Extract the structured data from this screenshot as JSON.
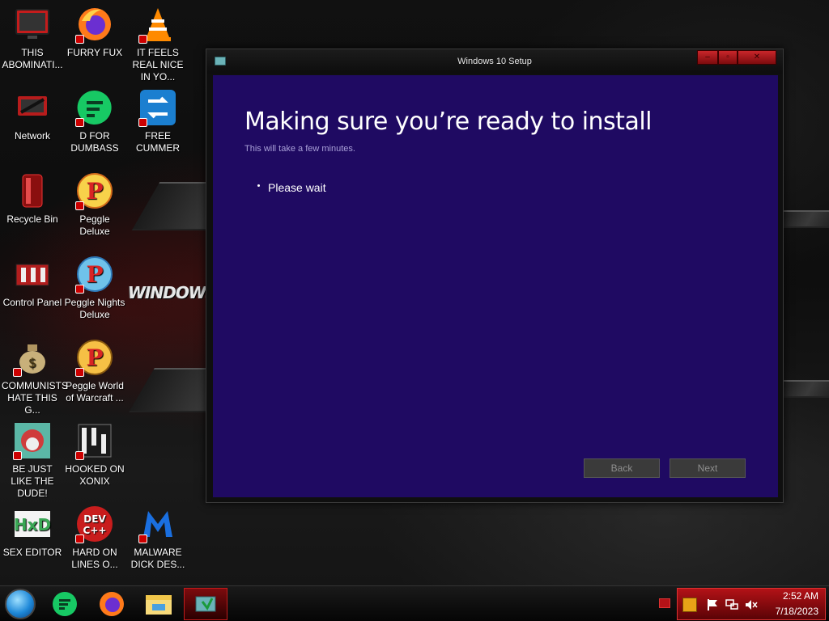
{
  "window": {
    "title": "Windows 10 Setup",
    "heading": "Making sure you’re ready to install",
    "subheading": "This will take a few minutes.",
    "status": "Please wait",
    "back_label": "Back",
    "next_label": "Next"
  },
  "desktop": {
    "wallpaper_logo": "WINDOWS",
    "icons": [
      {
        "label": "THIS ABOMINATI...",
        "icon": "monitor-icon"
      },
      {
        "label": "FURRY FUX",
        "icon": "firefox-icon"
      },
      {
        "label": "IT FEELS REAL NICE IN YO...",
        "icon": "vlc-cone-icon"
      },
      {
        "label": "Network",
        "icon": "network-icon"
      },
      {
        "label": "D FOR DUMBASS",
        "icon": "chat-app-icon"
      },
      {
        "label": "FREE CUMMER",
        "icon": "converter-icon"
      },
      {
        "label": "Recycle Bin",
        "icon": "recycle-bin-icon"
      },
      {
        "label": "Peggle Deluxe",
        "icon": "peggle-icon"
      },
      {
        "label": "Control Panel",
        "icon": "control-panel-icon"
      },
      {
        "label": "Peggle Nights Deluxe",
        "icon": "peggle-nights-icon"
      },
      {
        "label": "COMMUNISTS HATE THIS G...",
        "icon": "money-bag-icon"
      },
      {
        "label": "Peggle World of Warcraft ...",
        "icon": "peggle-wow-icon"
      },
      {
        "label": "BE JUST LIKE THE DUDE!",
        "icon": "game-character-icon"
      },
      {
        "label": "HOOKED ON XONIX",
        "icon": "xonix-icon"
      },
      {
        "label": "SEX EDITOR",
        "icon": "hex-editor-icon"
      },
      {
        "label": "HARD ON LINES O...",
        "icon": "dev-cpp-icon"
      },
      {
        "label": "MALWARE DICK DES...",
        "icon": "malwarebytes-icon"
      }
    ]
  },
  "taskbar": {
    "clock_time": "2:52 AM",
    "clock_date": "7/18/2023",
    "pinned": [
      {
        "icon": "start-orb-icon"
      },
      {
        "icon": "chat-app-icon"
      },
      {
        "icon": "firefox-icon"
      },
      {
        "icon": "file-explorer-icon"
      },
      {
        "icon": "windows-setup-icon",
        "active": true
      }
    ],
    "tray_icons": [
      "show-desktop-icon",
      "action-center-icon",
      "flag-icon",
      "network-tray-icon",
      "volume-muted-icon"
    ]
  },
  "colors": {
    "setup_panel": "#1f0a62",
    "accent_red": "#b31217"
  }
}
